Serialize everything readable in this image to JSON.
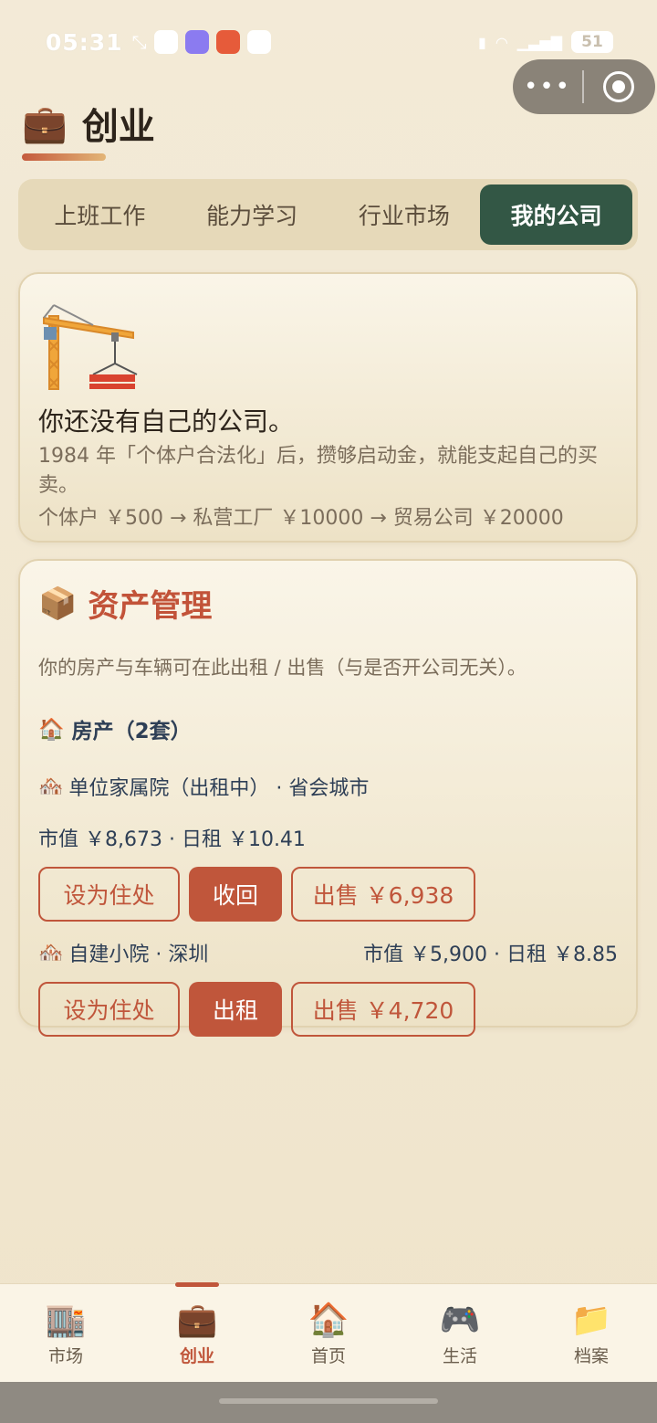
{
  "status": {
    "time": "05:31",
    "battery": "51"
  },
  "header": {
    "icon": "briefcase",
    "title": "创业"
  },
  "tabs": [
    {
      "label": "上班工作"
    },
    {
      "label": "能力学习"
    },
    {
      "label": "行业市场"
    },
    {
      "label": "我的公司",
      "active": true
    }
  ],
  "no_company": {
    "icon": "crane",
    "heading": "你还没有自己的公司。",
    "line1": "1984 年「个体户合法化」后，攒够启动金，就能支起自己的买卖。",
    "line2": "个体户 ￥500 → 私营工厂 ￥10000 → 贸易公司 ￥20000"
  },
  "assets": {
    "icon": "package",
    "title": "资产管理",
    "desc": "你的房产与车辆可在此出租 / 出售（与是否开公司无关）。",
    "property_heading": "房产（2套）",
    "properties": [
      {
        "name": "单位家属院（出租中） · 省会城市",
        "value": "市值 ￥8,673 · 日租 ￥10.41",
        "buttons": [
          "设为住处",
          "收回",
          "出售 ￥6,938"
        ]
      },
      {
        "name": "自建小院 · 深圳",
        "value": "市值 ￥5,900 · 日租 ￥8.85",
        "buttons": [
          "设为住处",
          "出租",
          "出售 ￥4,720"
        ]
      }
    ]
  },
  "nav": [
    {
      "icon": "building",
      "label": "市场"
    },
    {
      "icon": "briefcase",
      "label": "创业",
      "active": true
    },
    {
      "icon": "house",
      "label": "首页"
    },
    {
      "icon": "gamepad",
      "label": "生活"
    },
    {
      "icon": "folder",
      "label": "档案"
    }
  ],
  "colors": {
    "accent": "#c0563b",
    "tab_active": "#335745",
    "text_blue": "#2e3f56"
  }
}
